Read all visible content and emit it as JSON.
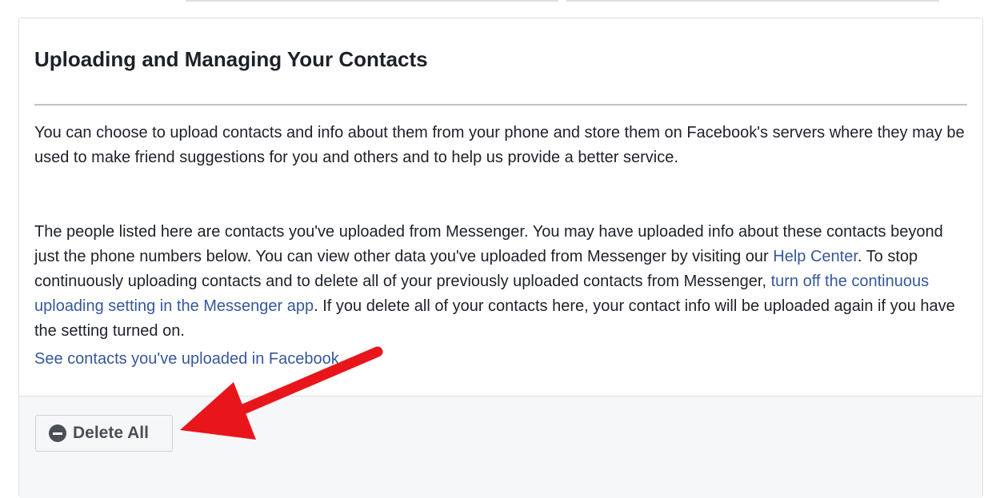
{
  "section": {
    "title": "Uploading and Managing Your Contacts",
    "intro_text": "You can choose to upload contacts and info about them from your phone and store them on Facebook's servers where they may be used to make friend suggestions for you and others and to help us provide a better service.",
    "detail": {
      "part1": "The people listed here are contacts you've uploaded from Messenger. You may have uploaded info about these contacts beyond just the phone numbers below. You can view other data you've uploaded from Messenger by visiting our ",
      "help_center_link": "Help Center",
      "part2": ". To stop continuously uploading contacts and to delete all of your previously uploaded contacts from Messenger, ",
      "setting_link": "turn off the continuous uploading setting in the Messenger app",
      "part3": ". If you delete all of your contacts here, your contact info will be uploaded again if you have the setting turned on."
    },
    "see_contacts_link": "See contacts you've uploaded in Facebook."
  },
  "footer": {
    "delete_button_label": "Delete All",
    "delete_icon": "minus-circle-icon"
  },
  "annotation": {
    "arrow_color": "#e8161b"
  },
  "colors": {
    "link": "#365899",
    "text": "#1d2129",
    "footer_bg": "#f6f7f9"
  }
}
